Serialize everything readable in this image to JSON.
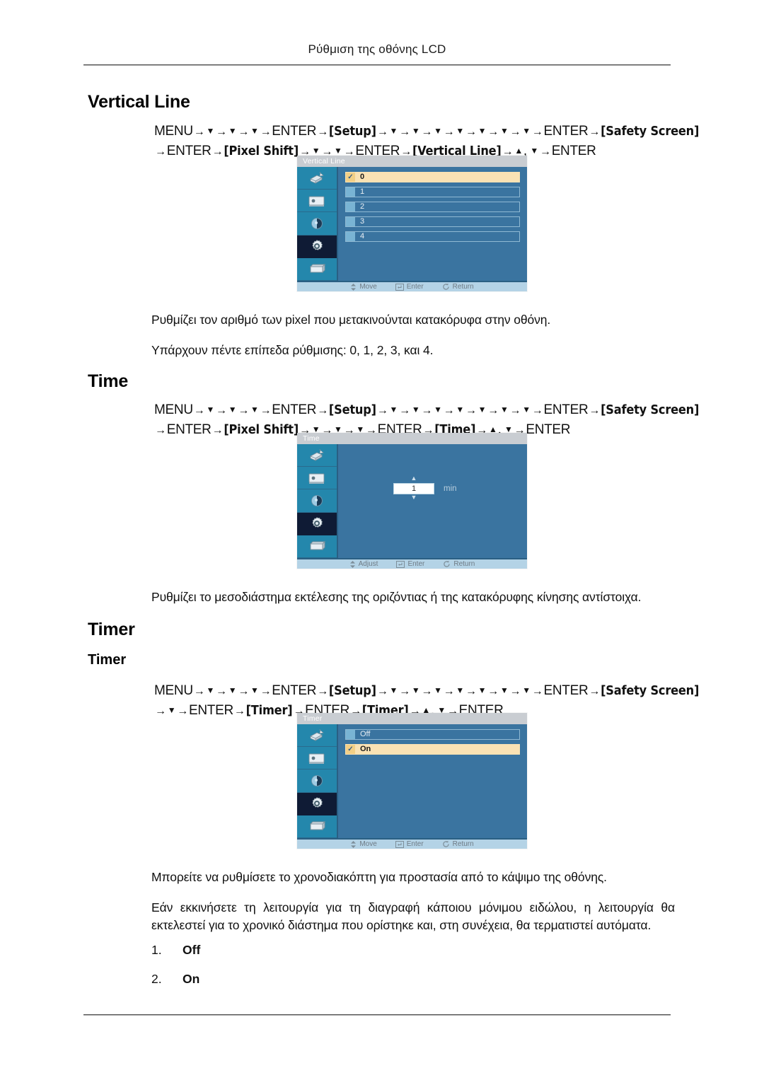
{
  "header": {
    "running_title": "Ρύθμιση της οθόνης LCD"
  },
  "sections": [
    {
      "id": "vertical-line",
      "title": "Vertical Line",
      "navpath": {
        "line1": [
          {
            "t": "text",
            "v": "MENU"
          },
          {
            "t": "arrow"
          },
          {
            "t": "down"
          },
          {
            "t": "arrow"
          },
          {
            "t": "down"
          },
          {
            "t": "arrow"
          },
          {
            "t": "down"
          },
          {
            "t": "arrow"
          },
          {
            "t": "text",
            "v": "ENTER"
          },
          {
            "t": "arrow"
          },
          {
            "t": "bracket",
            "v": "Setup"
          },
          {
            "t": "arrow"
          },
          {
            "t": "down"
          },
          {
            "t": "arrow"
          },
          {
            "t": "down"
          },
          {
            "t": "arrow"
          },
          {
            "t": "down"
          },
          {
            "t": "arrow"
          },
          {
            "t": "down"
          },
          {
            "t": "arrow"
          },
          {
            "t": "down"
          },
          {
            "t": "arrow"
          },
          {
            "t": "down"
          },
          {
            "t": "arrow"
          },
          {
            "t": "down"
          },
          {
            "t": "arrow"
          },
          {
            "t": "text",
            "v": "ENTER"
          },
          {
            "t": "arrow"
          },
          {
            "t": "bracket",
            "v": "Safety Screen"
          }
        ],
        "line2": [
          {
            "t": "arrow"
          },
          {
            "t": "text",
            "v": "ENTER"
          },
          {
            "t": "arrow"
          },
          {
            "t": "bracket",
            "v": "Pixel Shift"
          },
          {
            "t": "arrow"
          },
          {
            "t": "down"
          },
          {
            "t": "arrow"
          },
          {
            "t": "down"
          },
          {
            "t": "arrow"
          },
          {
            "t": "text",
            "v": "ENTER"
          },
          {
            "t": "arrow"
          },
          {
            "t": "bracket",
            "v": "Vertical Line"
          },
          {
            "t": "arrow"
          },
          {
            "t": "up"
          },
          {
            "t": "comma"
          },
          {
            "t": "down"
          },
          {
            "t": "arrow"
          },
          {
            "t": "text",
            "v": "ENTER"
          }
        ]
      },
      "osd": {
        "title": "Vertical Line",
        "kind": "options",
        "options": [
          {
            "label": "0",
            "selected": true
          },
          {
            "label": "1",
            "selected": false
          },
          {
            "label": "2",
            "selected": false
          },
          {
            "label": "3",
            "selected": false
          },
          {
            "label": "4",
            "selected": false
          }
        ],
        "footer": [
          {
            "icon": "updown-icon",
            "label": "Move"
          },
          {
            "icon": "enter-icon",
            "label": "Enter"
          },
          {
            "icon": "return-icon",
            "label": "Return"
          }
        ]
      },
      "paragraphs": [
        "Ρυθμίζει τον αριθμό των pixel που μετακινούνται κατακόρυφα στην οθόνη.",
        "Υπάρχουν πέντε επίπεδα ρύθμισης: 0, 1, 2, 3, και 4."
      ]
    },
    {
      "id": "time",
      "title": "Time",
      "navpath": {
        "line1": [
          {
            "t": "text",
            "v": "MENU"
          },
          {
            "t": "arrow"
          },
          {
            "t": "down"
          },
          {
            "t": "arrow"
          },
          {
            "t": "down"
          },
          {
            "t": "arrow"
          },
          {
            "t": "down"
          },
          {
            "t": "arrow"
          },
          {
            "t": "text",
            "v": "ENTER"
          },
          {
            "t": "arrow"
          },
          {
            "t": "bracket",
            "v": "Setup"
          },
          {
            "t": "arrow"
          },
          {
            "t": "down"
          },
          {
            "t": "arrow"
          },
          {
            "t": "down"
          },
          {
            "t": "arrow"
          },
          {
            "t": "down"
          },
          {
            "t": "arrow"
          },
          {
            "t": "down"
          },
          {
            "t": "arrow"
          },
          {
            "t": "down"
          },
          {
            "t": "arrow"
          },
          {
            "t": "down"
          },
          {
            "t": "arrow"
          },
          {
            "t": "down"
          },
          {
            "t": "arrow"
          },
          {
            "t": "text",
            "v": "ENTER"
          },
          {
            "t": "arrow"
          },
          {
            "t": "bracket",
            "v": "Safety Screen"
          }
        ],
        "line2": [
          {
            "t": "arrow"
          },
          {
            "t": "text",
            "v": "ENTER"
          },
          {
            "t": "arrow"
          },
          {
            "t": "bracket",
            "v": "Pixel Shift"
          },
          {
            "t": "arrow"
          },
          {
            "t": "down"
          },
          {
            "t": "arrow"
          },
          {
            "t": "down"
          },
          {
            "t": "arrow"
          },
          {
            "t": "down"
          },
          {
            "t": "arrow"
          },
          {
            "t": "text",
            "v": "ENTER"
          },
          {
            "t": "arrow"
          },
          {
            "t": "bracket",
            "v": "Time"
          },
          {
            "t": "arrow"
          },
          {
            "t": "up"
          },
          {
            "t": "comma"
          },
          {
            "t": "down"
          },
          {
            "t": "arrow"
          },
          {
            "t": "text",
            "v": "ENTER"
          }
        ]
      },
      "osd": {
        "title": "Time",
        "kind": "spinner",
        "spinner": {
          "value": "1",
          "unit": "min"
        },
        "footer": [
          {
            "icon": "updown-icon",
            "label": "Adjust"
          },
          {
            "icon": "enter-icon",
            "label": "Enter"
          },
          {
            "icon": "return-icon",
            "label": "Return"
          }
        ]
      },
      "paragraphs": [
        "Ρυθμίζει το μεσοδιάστημα εκτέλεσης της οριζόντιας ή της κατακόρυφης κίνησης αντίστοιχα."
      ]
    },
    {
      "id": "timer",
      "title": "Timer",
      "subtitle": "Timer",
      "navpath": {
        "line1": [
          {
            "t": "text",
            "v": "MENU"
          },
          {
            "t": "arrow"
          },
          {
            "t": "down"
          },
          {
            "t": "arrow"
          },
          {
            "t": "down"
          },
          {
            "t": "arrow"
          },
          {
            "t": "down"
          },
          {
            "t": "arrow"
          },
          {
            "t": "text",
            "v": "ENTER"
          },
          {
            "t": "arrow"
          },
          {
            "t": "bracket",
            "v": "Setup"
          },
          {
            "t": "arrow"
          },
          {
            "t": "down"
          },
          {
            "t": "arrow"
          },
          {
            "t": "down"
          },
          {
            "t": "arrow"
          },
          {
            "t": "down"
          },
          {
            "t": "arrow"
          },
          {
            "t": "down"
          },
          {
            "t": "arrow"
          },
          {
            "t": "down"
          },
          {
            "t": "arrow"
          },
          {
            "t": "down"
          },
          {
            "t": "arrow"
          },
          {
            "t": "down"
          },
          {
            "t": "arrow"
          },
          {
            "t": "text",
            "v": "ENTER"
          },
          {
            "t": "arrow"
          },
          {
            "t": "bracket",
            "v": "Safety Screen"
          }
        ],
        "line2": [
          {
            "t": "arrow"
          },
          {
            "t": "down"
          },
          {
            "t": "arrow"
          },
          {
            "t": "text",
            "v": "ENTER"
          },
          {
            "t": "arrow"
          },
          {
            "t": "bracket",
            "v": "Timer"
          },
          {
            "t": "arrow"
          },
          {
            "t": "text",
            "v": "ENTER"
          },
          {
            "t": "arrow"
          },
          {
            "t": "bracket",
            "v": "Timer"
          },
          {
            "t": "arrow"
          },
          {
            "t": "up"
          },
          {
            "t": "comma"
          },
          {
            "t": "down"
          },
          {
            "t": "arrow"
          },
          {
            "t": "text",
            "v": "ENTER"
          }
        ]
      },
      "osd": {
        "title": "Timer",
        "kind": "options",
        "options": [
          {
            "label": "Off",
            "selected": false
          },
          {
            "label": "On",
            "selected": true
          }
        ],
        "footer": [
          {
            "icon": "updown-icon",
            "label": "Move"
          },
          {
            "icon": "enter-icon",
            "label": "Enter"
          },
          {
            "icon": "return-icon",
            "label": "Return"
          }
        ]
      },
      "paragraphs": [
        "Μπορείτε να ρυθμίσετε το χρονοδιακόπτη για προστασία από το κάψιμο της οθόνης.",
        "Εάν εκκινήσετε τη λειτουργία για τη διαγραφή κάποιου μόνιμου ειδώλου, η λειτουργία θα εκτελεστεί για το χρονικό διάστημα που ορίστηκε και, στη συνέχεια, θα τερματιστεί αυτόματα."
      ],
      "list": [
        {
          "num": "1.",
          "text": "Off"
        },
        {
          "num": "2.",
          "text": "On"
        }
      ]
    }
  ],
  "osd_sidebar_icons": [
    "input-source-icon",
    "picture-icon",
    "sound-icon",
    "setup-gear-icon",
    "multi-control-icon"
  ],
  "colors": {
    "osd_background": "#3a74a0",
    "osd_sidebar": "#2487ac",
    "osd_sidebar_active": "#0f1b35",
    "osd_titlebar": "#c9cdd2",
    "osd_footer": "#b4d3e6",
    "osd_selected_row": "#fae2b4",
    "osd_swatch": "#79b4d4"
  }
}
